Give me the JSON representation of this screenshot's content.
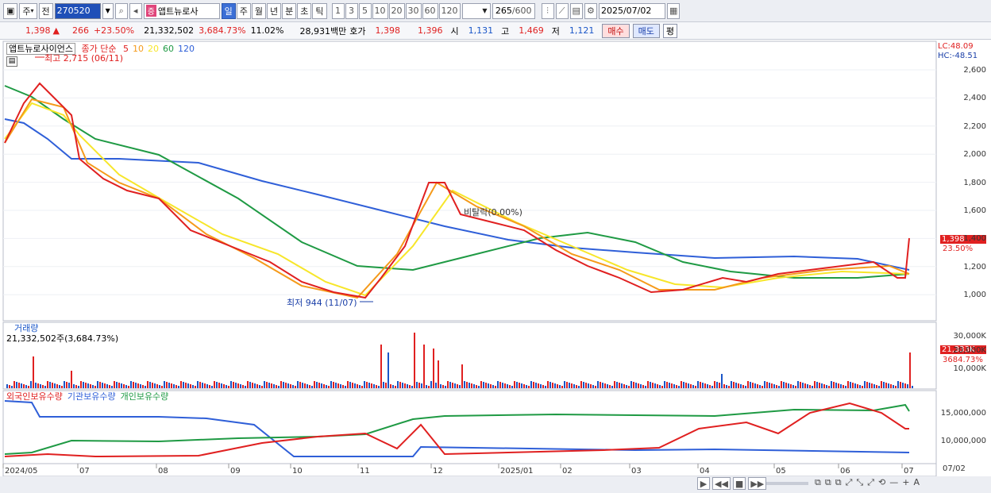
{
  "toolbar": {
    "period_select": "주",
    "prev_label": "전",
    "code": "270520",
    "name_badge": "증",
    "name": "앱트뉴로사",
    "timeframes": [
      "일",
      "주",
      "월",
      "년",
      "분",
      "초",
      "틱"
    ],
    "active_timeframe": "일",
    "intervals": [
      "1",
      "3",
      "5",
      "10",
      "20",
      "30",
      "60",
      "120"
    ],
    "bar_count": "265",
    "bar_max": "/600",
    "date": "2025/07/02"
  },
  "quote": {
    "price": "1,398",
    "arrow": "▲",
    "change": "266",
    "change_pct": "+23.50%",
    "volume": "21,332,502",
    "volume_pct": "3,684.73%",
    "turnover": "11.02%",
    "amount": "28,931백만",
    "bid_label": "호가",
    "ask": "1,398",
    "bid": "1,396",
    "open_label": "시",
    "open": "1,131",
    "high_label": "고",
    "high": "1,469",
    "low_label": "저",
    "low": "1,121",
    "buy_label": "매수",
    "sell_label": "매도",
    "flat_label": "평"
  },
  "price_panel": {
    "title": "앱트뉴로사이언스",
    "ma_label": "종가 단순",
    "ma_periods": [
      "5",
      "10",
      "20",
      "60",
      "120"
    ],
    "ma_colors": [
      "#e02020",
      "#f59a1a",
      "#f7e62a",
      "#1f9a44",
      "#2f5fd8"
    ],
    "high_note": "최고 2,715 (06/11)",
    "low_note": "최저 944 (11/07)",
    "vi_note": "비탈락(0.00%)",
    "lc": "LC:48.09",
    "hc": "HC:-48.51",
    "current_price": "1,398",
    "current_pct": "23.50%",
    "y_ticks": [
      "2,600",
      "2,400",
      "2,200",
      "2,000",
      "1,800",
      "1,600",
      "1,400",
      "1,200",
      "1,000"
    ]
  },
  "volume_panel": {
    "title": "거래량",
    "value": "21,332,502주(3,684.73%)",
    "y_ticks": [
      "30,000K",
      "20,000K",
      "10,000K"
    ],
    "current": "21,333K",
    "current_pct": "3684.73%"
  },
  "holding_panel": {
    "series": [
      "외국인보유수량",
      "기관보유수량",
      "개인보유수량"
    ],
    "colors": [
      "#e02020",
      "#2f5fd8",
      "#1f9a44"
    ],
    "y_ticks": [
      "15,000,000",
      "10,000,000"
    ]
  },
  "x_axis": {
    "labels": [
      "2024/05",
      "07",
      "08",
      "09",
      "10",
      "11",
      "12",
      "2025/01",
      "02",
      "03",
      "04",
      "05",
      "06",
      "07"
    ],
    "right_label": "07/02"
  }
}
